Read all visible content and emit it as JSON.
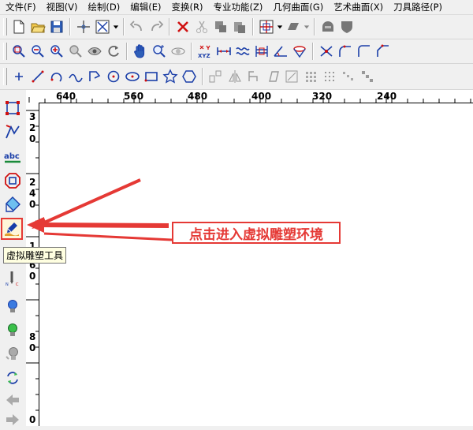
{
  "menu": [
    "文件(F)",
    "视图(V)",
    "绘制(D)",
    "编辑(E)",
    "变换(R)",
    "专业功能(Z)",
    "几何曲面(G)",
    "艺术曲面(X)",
    "刀具路径(P)"
  ],
  "ruler_top": [
    "640",
    "560",
    "480",
    "400",
    "320",
    "240"
  ],
  "ruler_left": [
    [
      "3",
      "2",
      "0"
    ],
    [
      "2",
      "4",
      "0"
    ],
    [
      "1",
      "6",
      "0"
    ],
    [
      "8",
      "0"
    ],
    [
      "0"
    ]
  ],
  "tooltip": "虚拟雕塑工具",
  "callout": "点击进入虚拟雕塑环境",
  "colors": {
    "accent": "#e53935",
    "icon_blue": "#1a3ea8",
    "icon_red": "#d01010"
  },
  "icons": {
    "toolbar1": [
      "new-file-icon",
      "open-folder-icon",
      "save-icon",
      "crosshair-icon",
      "select-box-icon",
      "undo-icon",
      "redo-icon",
      "delete-icon",
      "cut-icon",
      "copy-icon",
      "paste-icon",
      "grid-icon",
      "shape-fill-icon",
      "helmet-icon",
      "shield-icon"
    ],
    "toolbar2": [
      "zoom-window-icon",
      "zoom-out-icon",
      "zoom-in-icon",
      "zoom-all-icon",
      "view-eye-icon",
      "refresh-view-icon",
      "pan-hand-icon",
      "zoom-dynamic-icon",
      "orbit-icon",
      "xyz-icon",
      "measure-distance-icon",
      "wave-icon",
      "align-icon",
      "angle-icon",
      "cone-icon",
      "trim-icon",
      "fillet-icon",
      "corner-icon",
      "chamfer-icon"
    ],
    "toolbar3": [
      "point-icon",
      "line-icon",
      "arc-icon",
      "spline-icon",
      "polyline-icon",
      "circle-icon",
      "ellipse-icon",
      "rectangle-icon",
      "star-icon",
      "polygon-icon"
    ],
    "left": [
      "node-edit-icon",
      "vector-icon",
      "text-icon",
      "offset-icon",
      "shape-icon",
      "virtual-sculpt-icon",
      "back-icon",
      "nc-icon",
      "bulb-blue-icon",
      "bulb-green-icon",
      "bulb-gray-icon",
      "transform-icon",
      "arrow-left-icon",
      "arrow-right-icon"
    ]
  }
}
